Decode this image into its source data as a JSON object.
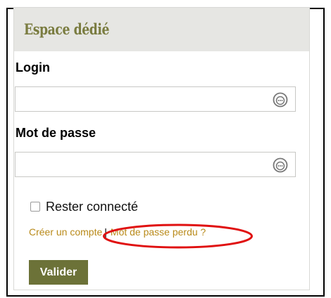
{
  "panel": {
    "title": "Espace dédié"
  },
  "form": {
    "login": {
      "label": "Login",
      "value": "",
      "icon": "password-manager-icon"
    },
    "password": {
      "label": "Mot de passe",
      "value": "",
      "icon": "password-manager-icon"
    },
    "remember": {
      "label": "Rester connecté",
      "checked": false
    },
    "links": {
      "create_account": "Créer un compte",
      "separator": "|",
      "lost_password": "Mot de passe perdu ?"
    },
    "submit_label": "Valider"
  },
  "colors": {
    "title": "#7a7c40",
    "header_background": "#e6e6e3",
    "link": "#b98a1a",
    "button_background": "#6c7238",
    "annotation": "#e01010"
  }
}
